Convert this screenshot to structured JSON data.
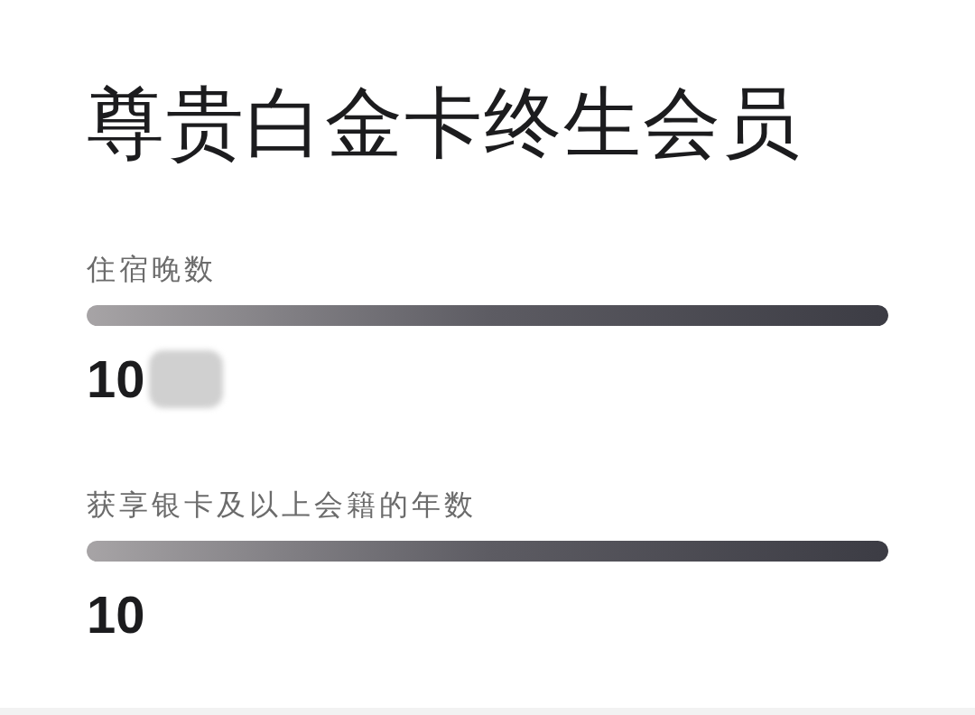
{
  "title": "尊贵白金卡终生会员",
  "metrics": [
    {
      "label": "住宿晚数",
      "level": 1,
      "value": "10",
      "redacted": true
    },
    {
      "label": "获享银卡及以上会籍的年数",
      "level": 1,
      "value": "10",
      "redacted": false
    }
  ]
}
